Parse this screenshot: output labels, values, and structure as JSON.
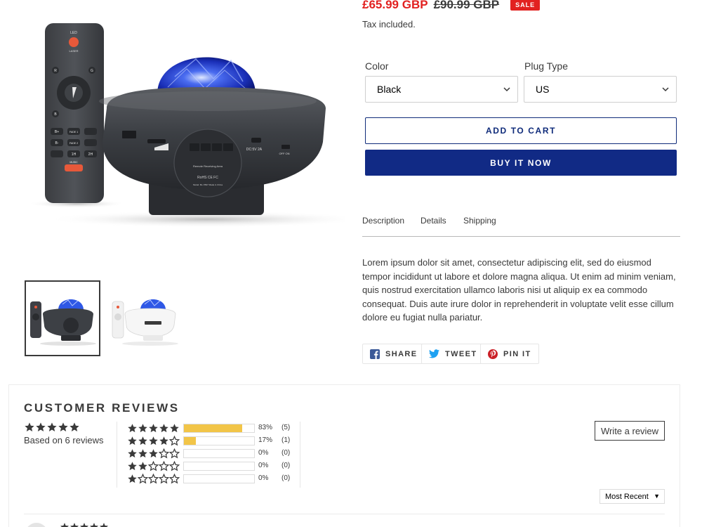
{
  "product": {
    "price_sale": "£65.99 GBP",
    "price_regular": "£90.99 GBP",
    "sale_badge": "SALE",
    "tax_note": "Tax included.",
    "options": {
      "color_label": "Color",
      "color_value": "Black",
      "plug_label": "Plug Type",
      "plug_value": "US"
    },
    "add_to_cart": "ADD TO CART",
    "buy_now": "BUY IT NOW"
  },
  "remote": {
    "led": "LED",
    "laser": "LASER",
    "r": "R",
    "g": "G",
    "b": "B",
    "b_plus": "B+",
    "b_minus": "B-",
    "fade1": "FADE 1",
    "fade2": "FADE 2",
    "one_h": "1H",
    "two_h": "2H",
    "music": "MUSIC"
  },
  "device": {
    "power_label": "DC:5V 2A",
    "switch_label": "OFF ON",
    "panel_label": "Remote Receiving Area",
    "cert_label": "RoHS CE FC",
    "model_label": "Model: BL-YB07   Made in China"
  },
  "tabs": [
    "Description",
    "Details",
    "Shipping"
  ],
  "description": "Lorem ipsum dolor sit amet, consectetur adipiscing elit, sed do eiusmod tempor incididunt ut labore et dolore magna aliqua. Ut enim ad minim veniam, quis nostrud exercitation ullamco laboris nisi ut aliquip ex ea commodo consequat. Duis aute irure dolor in reprehenderit in voluptate velit esse cillum dolore eu fugiat nulla pariatur.",
  "share": {
    "facebook": "SHARE",
    "twitter": "TWEET",
    "pinterest": "PIN IT"
  },
  "reviews": {
    "title": "CUSTOMER REVIEWS",
    "average_stars": 5,
    "based_on": "Based on 6 reviews",
    "histogram": [
      {
        "stars": 5,
        "fraction": 0.83,
        "percent": "83%",
        "count": "(5)"
      },
      {
        "stars": 4,
        "fraction": 0.17,
        "percent": "17%",
        "count": "(1)"
      },
      {
        "stars": 3,
        "fraction": 0,
        "percent": "0%",
        "count": "(0)"
      },
      {
        "stars": 2,
        "fraction": 0,
        "percent": "0%",
        "count": "(0)"
      },
      {
        "stars": 1,
        "fraction": 0,
        "percent": "0%",
        "count": "(0)"
      }
    ],
    "write_review": "Write a review",
    "sort_value": "Most Recent"
  },
  "colors": {
    "sale_red": "#e22120",
    "brand_navy": "#112a85",
    "star_fill": "#f2c548",
    "text": "#3a3a3a"
  },
  "icons": {
    "select_arrow": "chevron-down-icon",
    "facebook": "facebook-icon",
    "twitter": "twitter-icon",
    "pinterest": "pinterest-icon",
    "star": "star-icon"
  }
}
